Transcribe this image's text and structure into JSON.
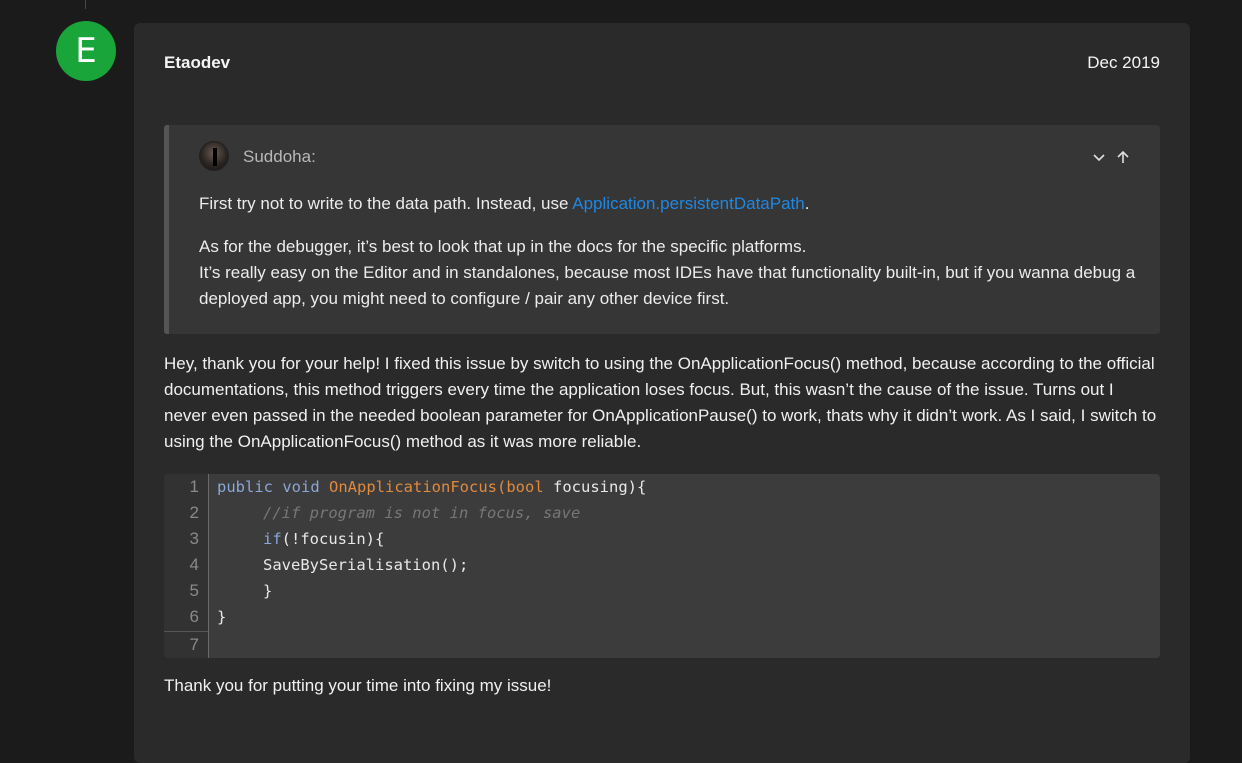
{
  "post": {
    "avatar_letter": "E",
    "avatar_color": "#1aa53b",
    "author": "Etaodev",
    "date": "Dec 2019"
  },
  "quote": {
    "author": "Suddoha:",
    "controls": {
      "expand_icon": "chevron-down-icon",
      "jump_icon": "arrow-up-icon"
    },
    "paragraph1_prefix": "First try not to write to the data path. Instead, use ",
    "paragraph1_link": "Application.persistentDataPath",
    "paragraph1_suffix": ".",
    "paragraph2_line1": "As for the debugger, it’s best to look that up in the docs for the specific platforms.",
    "paragraph2_line2": "It’s really easy on the Editor and in standalones, because most IDEs have that functionality built-in, but if you wanna debug a deployed app, you might need to configure / pair any other device first."
  },
  "reply_text": "Hey, thank you for your help! I fixed this issue by switch to using the OnApplicationFocus() method, because according to the official documentations, this method triggers every time the application loses focus. But, this wasn’t the cause of the issue. Turns out I never even passed in the needed boolean parameter for OnApplicationPause() to work, thats why it didn’t work. As I said, I switch to using the OnApplicationFocus() method as it was more reliable.",
  "code": {
    "line_numbers": [
      "1",
      "2",
      "3",
      "4",
      "5",
      "6",
      "7"
    ],
    "line1": {
      "kw1": "public",
      "kw2": "void",
      "fn": "OnApplicationFocus",
      "open": "(",
      "type": "bool",
      "rest": " focusing){"
    },
    "line2": "//if program is not in focus, save",
    "line3": {
      "kw": "if",
      "rest": "(!focusin){"
    },
    "line4": "SaveBySerialisation();",
    "line5": "}",
    "line6": "}",
    "line7": ""
  },
  "closing_text": "Thank you for putting your time into fixing my issue!",
  "colors": {
    "link": "#1e88e5",
    "keyword": "#8aa6d6",
    "function": "#e08a3c",
    "comment": "#777777"
  }
}
